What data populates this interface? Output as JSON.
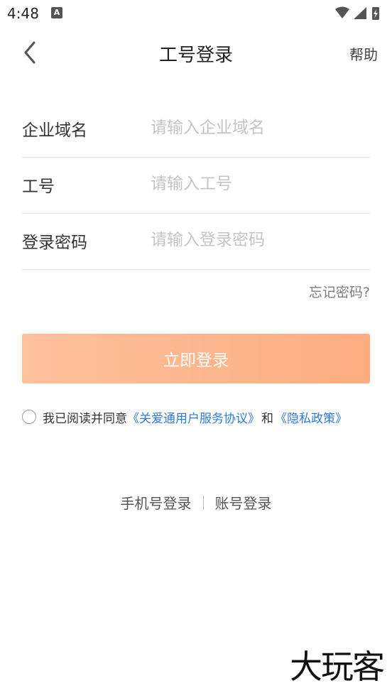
{
  "status_bar": {
    "time": "4:48",
    "notification_badge": "A",
    "icons": [
      "wifi-icon",
      "signal-icon",
      "battery-charging-icon"
    ]
  },
  "nav": {
    "back_icon": "chevron-left-icon",
    "title": "工号登录",
    "help": "帮助"
  },
  "form": {
    "domain": {
      "label": "企业域名",
      "placeholder": "请输入企业域名",
      "value": ""
    },
    "employee_id": {
      "label": "工号",
      "placeholder": "请输入工号",
      "value": ""
    },
    "password": {
      "label": "登录密码",
      "placeholder": "请输入登录密码",
      "value": ""
    },
    "forgot": "忘记密码?"
  },
  "login_button": {
    "label": "立即登录",
    "gradient_start": "#fdc19c",
    "gradient_end": "#fcad80"
  },
  "agreement": {
    "checked": false,
    "prefix": "我已阅读并同意",
    "user_agreement": "《关爱通用户服务协议》",
    "and": "和",
    "privacy_policy": "《隐私政策》",
    "link_color": "#2f7ad6"
  },
  "alt_login": {
    "phone": "手机号登录",
    "account": "账号登录"
  },
  "watermark": "大玩客"
}
